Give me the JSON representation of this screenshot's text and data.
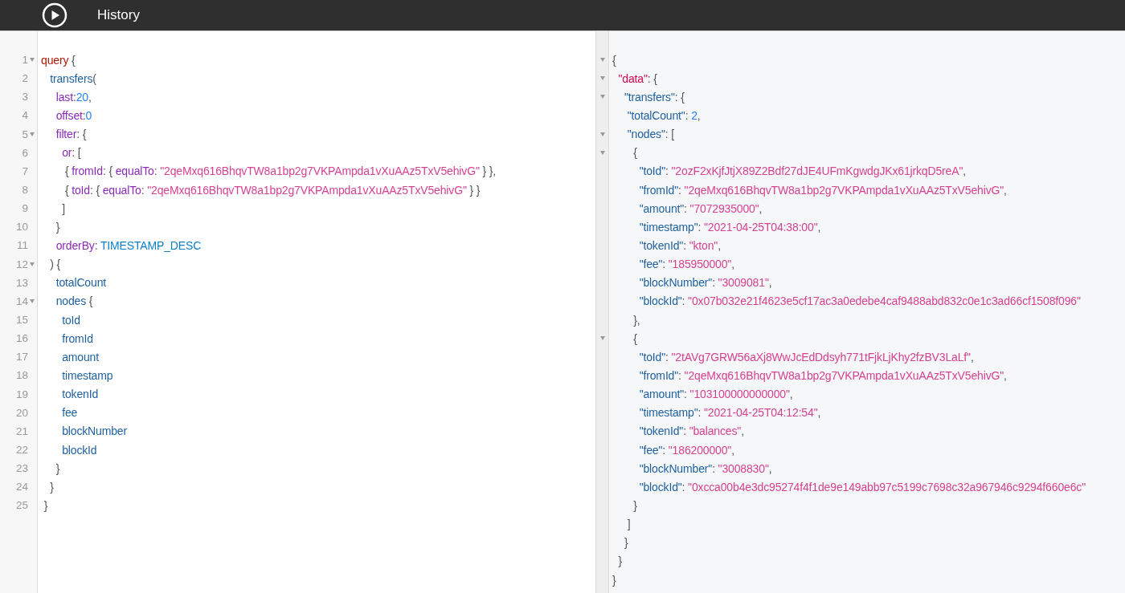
{
  "toolbar": {
    "title": "History"
  },
  "query_editor": {
    "lines": [
      {
        "number": "1",
        "foldable": true,
        "tokens": [
          {
            "text": "query",
            "kind": "keyword"
          },
          {
            "text": " {",
            "kind": "punct"
          }
        ]
      },
      {
        "number": "2",
        "foldable": false,
        "tokens": [
          {
            "text": "   transfers",
            "kind": "def"
          },
          {
            "text": "(",
            "kind": "punct"
          }
        ]
      },
      {
        "number": "3",
        "foldable": false,
        "tokens": [
          {
            "text": "     last",
            "kind": "arg"
          },
          {
            "text": ":",
            "kind": "punct"
          },
          {
            "text": "20",
            "kind": "number"
          },
          {
            "text": ",",
            "kind": "punct"
          }
        ]
      },
      {
        "number": "4",
        "foldable": false,
        "tokens": [
          {
            "text": "     offset",
            "kind": "arg"
          },
          {
            "text": ":",
            "kind": "punct"
          },
          {
            "text": "0",
            "kind": "number"
          }
        ]
      },
      {
        "number": "5",
        "foldable": true,
        "tokens": [
          {
            "text": "     filter",
            "kind": "arg"
          },
          {
            "text": ": {",
            "kind": "punct"
          }
        ]
      },
      {
        "number": "6",
        "foldable": false,
        "tokens": [
          {
            "text": "       or",
            "kind": "arg"
          },
          {
            "text": ": [",
            "kind": "punct"
          }
        ]
      },
      {
        "number": "7",
        "foldable": false,
        "tokens": [
          {
            "text": "        { ",
            "kind": "punct"
          },
          {
            "text": "fromId",
            "kind": "arg"
          },
          {
            "text": ": { ",
            "kind": "punct"
          },
          {
            "text": "equalTo",
            "kind": "arg"
          },
          {
            "text": ": ",
            "kind": "punct"
          },
          {
            "text": "\"2qeMxq616BhqvTW8a1bp2g7VKPAmpda1vXuAAz5TxV5ehivG\"",
            "kind": "string"
          },
          {
            "text": " } },",
            "kind": "punct"
          }
        ]
      },
      {
        "number": "8",
        "foldable": false,
        "tokens": [
          {
            "text": "        { ",
            "kind": "punct"
          },
          {
            "text": "toId",
            "kind": "arg"
          },
          {
            "text": ": { ",
            "kind": "punct"
          },
          {
            "text": "equalTo",
            "kind": "arg"
          },
          {
            "text": ": ",
            "kind": "punct"
          },
          {
            "text": "\"2qeMxq616BhqvTW8a1bp2g7VKPAmpda1vXuAAz5TxV5ehivG\"",
            "kind": "string"
          },
          {
            "text": " } }",
            "kind": "punct"
          }
        ]
      },
      {
        "number": "9",
        "foldable": false,
        "tokens": [
          {
            "text": "       ]",
            "kind": "punct"
          }
        ]
      },
      {
        "number": "10",
        "foldable": false,
        "tokens": [
          {
            "text": "     }",
            "kind": "punct"
          }
        ]
      },
      {
        "number": "11",
        "foldable": false,
        "tokens": [
          {
            "text": "     orderBy",
            "kind": "arg"
          },
          {
            "text": ": ",
            "kind": "punct"
          },
          {
            "text": "TIMESTAMP_DESC",
            "kind": "enum"
          }
        ]
      },
      {
        "number": "12",
        "foldable": true,
        "tokens": [
          {
            "text": "   ) {",
            "kind": "punct"
          }
        ]
      },
      {
        "number": "13",
        "foldable": false,
        "tokens": [
          {
            "text": "     totalCount",
            "kind": "def"
          }
        ]
      },
      {
        "number": "14",
        "foldable": true,
        "tokens": [
          {
            "text": "     nodes",
            "kind": "def"
          },
          {
            "text": " {",
            "kind": "punct"
          }
        ]
      },
      {
        "number": "15",
        "foldable": false,
        "tokens": [
          {
            "text": "       toId",
            "kind": "def"
          }
        ]
      },
      {
        "number": "16",
        "foldable": false,
        "tokens": [
          {
            "text": "       fromId",
            "kind": "def"
          }
        ]
      },
      {
        "number": "17",
        "foldable": false,
        "tokens": [
          {
            "text": "       amount",
            "kind": "def"
          }
        ]
      },
      {
        "number": "18",
        "foldable": false,
        "tokens": [
          {
            "text": "       timestamp",
            "kind": "def"
          }
        ]
      },
      {
        "number": "19",
        "foldable": false,
        "tokens": [
          {
            "text": "       tokenId",
            "kind": "def"
          }
        ]
      },
      {
        "number": "20",
        "foldable": false,
        "tokens": [
          {
            "text": "       fee",
            "kind": "def"
          }
        ]
      },
      {
        "number": "21",
        "foldable": false,
        "tokens": [
          {
            "text": "       blockNumber",
            "kind": "def"
          }
        ]
      },
      {
        "number": "22",
        "foldable": false,
        "tokens": [
          {
            "text": "       blockId",
            "kind": "def"
          }
        ]
      },
      {
        "number": "23",
        "foldable": false,
        "tokens": [
          {
            "text": "     }",
            "kind": "punct"
          }
        ]
      },
      {
        "number": "24",
        "foldable": false,
        "tokens": [
          {
            "text": "   }",
            "kind": "punct"
          }
        ]
      },
      {
        "number": "25",
        "foldable": false,
        "tokens": [
          {
            "text": " }",
            "kind": "punct"
          }
        ]
      }
    ]
  },
  "result_viewer": {
    "lines": [
      {
        "foldable": true,
        "tokens": [
          {
            "text": "{",
            "kind": "punct"
          }
        ]
      },
      {
        "foldable": true,
        "tokens": [
          {
            "text": "  \"data\"",
            "kind": "root-key"
          },
          {
            "text": ": {",
            "kind": "punct"
          }
        ]
      },
      {
        "foldable": true,
        "tokens": [
          {
            "text": "    \"transfers\"",
            "kind": "key"
          },
          {
            "text": ": {",
            "kind": "punct"
          }
        ]
      },
      {
        "foldable": false,
        "tokens": [
          {
            "text": "     \"totalCount\"",
            "kind": "key"
          },
          {
            "text": ": ",
            "kind": "punct"
          },
          {
            "text": "2",
            "kind": "number"
          },
          {
            "text": ",",
            "kind": "punct"
          }
        ]
      },
      {
        "foldable": true,
        "tokens": [
          {
            "text": "     \"nodes\"",
            "kind": "key"
          },
          {
            "text": ": [",
            "kind": "punct"
          }
        ]
      },
      {
        "foldable": true,
        "tokens": [
          {
            "text": "       {",
            "kind": "punct"
          }
        ]
      },
      {
        "foldable": false,
        "tokens": [
          {
            "text": "         \"toId\"",
            "kind": "key"
          },
          {
            "text": ": ",
            "kind": "punct"
          },
          {
            "text": "\"2ozF2xKjfJtjX89Z2Bdf27dJE4UFmKgwdgJKx61jrkqD5reA\"",
            "kind": "string"
          },
          {
            "text": ",",
            "kind": "punct"
          }
        ]
      },
      {
        "foldable": false,
        "tokens": [
          {
            "text": "         \"fromId\"",
            "kind": "key"
          },
          {
            "text": ": ",
            "kind": "punct"
          },
          {
            "text": "\"2qeMxq616BhqvTW8a1bp2g7VKPAmpda1vXuAAz5TxV5ehivG\"",
            "kind": "string"
          },
          {
            "text": ",",
            "kind": "punct"
          }
        ]
      },
      {
        "foldable": false,
        "tokens": [
          {
            "text": "         \"amount\"",
            "kind": "key"
          },
          {
            "text": ": ",
            "kind": "punct"
          },
          {
            "text": "\"7072935000\"",
            "kind": "string"
          },
          {
            "text": ",",
            "kind": "punct"
          }
        ]
      },
      {
        "foldable": false,
        "tokens": [
          {
            "text": "         \"timestamp\"",
            "kind": "key"
          },
          {
            "text": ": ",
            "kind": "punct"
          },
          {
            "text": "\"2021-04-25T04:38:00\"",
            "kind": "string"
          },
          {
            "text": ",",
            "kind": "punct"
          }
        ]
      },
      {
        "foldable": false,
        "tokens": [
          {
            "text": "         \"tokenId\"",
            "kind": "key"
          },
          {
            "text": ": ",
            "kind": "punct"
          },
          {
            "text": "\"kton\"",
            "kind": "string"
          },
          {
            "text": ",",
            "kind": "punct"
          }
        ]
      },
      {
        "foldable": false,
        "tokens": [
          {
            "text": "         \"fee\"",
            "kind": "key"
          },
          {
            "text": ": ",
            "kind": "punct"
          },
          {
            "text": "\"185950000\"",
            "kind": "string"
          },
          {
            "text": ",",
            "kind": "punct"
          }
        ]
      },
      {
        "foldable": false,
        "tokens": [
          {
            "text": "         \"blockNumber\"",
            "kind": "key"
          },
          {
            "text": ": ",
            "kind": "punct"
          },
          {
            "text": "\"3009081\"",
            "kind": "string"
          },
          {
            "text": ",",
            "kind": "punct"
          }
        ]
      },
      {
        "foldable": false,
        "tokens": [
          {
            "text": "         \"blockId\"",
            "kind": "key"
          },
          {
            "text": ": ",
            "kind": "punct"
          },
          {
            "text": "\"0x07b032e21f4623e5cf17ac3a0edebe4caf9488abd832c0e1c3ad66cf1508f096\"",
            "kind": "string"
          }
        ]
      },
      {
        "foldable": false,
        "tokens": [
          {
            "text": "       },",
            "kind": "punct"
          }
        ]
      },
      {
        "foldable": true,
        "tokens": [
          {
            "text": "       {",
            "kind": "punct"
          }
        ]
      },
      {
        "foldable": false,
        "tokens": [
          {
            "text": "         \"toId\"",
            "kind": "key"
          },
          {
            "text": ": ",
            "kind": "punct"
          },
          {
            "text": "\"2tAVg7GRW56aXj8WwJcEdDdsyh771tFjkLjKhy2fzBV3LaLf\"",
            "kind": "string"
          },
          {
            "text": ",",
            "kind": "punct"
          }
        ]
      },
      {
        "foldable": false,
        "tokens": [
          {
            "text": "         \"fromId\"",
            "kind": "key"
          },
          {
            "text": ": ",
            "kind": "punct"
          },
          {
            "text": "\"2qeMxq616BhqvTW8a1bp2g7VKPAmpda1vXuAAz5TxV5ehivG\"",
            "kind": "string"
          },
          {
            "text": ",",
            "kind": "punct"
          }
        ]
      },
      {
        "foldable": false,
        "tokens": [
          {
            "text": "         \"amount\"",
            "kind": "key"
          },
          {
            "text": ": ",
            "kind": "punct"
          },
          {
            "text": "\"103100000000000\"",
            "kind": "string"
          },
          {
            "text": ",",
            "kind": "punct"
          }
        ]
      },
      {
        "foldable": false,
        "tokens": [
          {
            "text": "         \"timestamp\"",
            "kind": "key"
          },
          {
            "text": ": ",
            "kind": "punct"
          },
          {
            "text": "\"2021-04-25T04:12:54\"",
            "kind": "string"
          },
          {
            "text": ",",
            "kind": "punct"
          }
        ]
      },
      {
        "foldable": false,
        "tokens": [
          {
            "text": "         \"tokenId\"",
            "kind": "key"
          },
          {
            "text": ": ",
            "kind": "punct"
          },
          {
            "text": "\"balances\"",
            "kind": "string"
          },
          {
            "text": ",",
            "kind": "punct"
          }
        ]
      },
      {
        "foldable": false,
        "tokens": [
          {
            "text": "         \"fee\"",
            "kind": "key"
          },
          {
            "text": ": ",
            "kind": "punct"
          },
          {
            "text": "\"186200000\"",
            "kind": "string"
          },
          {
            "text": ",",
            "kind": "punct"
          }
        ]
      },
      {
        "foldable": false,
        "tokens": [
          {
            "text": "         \"blockNumber\"",
            "kind": "key"
          },
          {
            "text": ": ",
            "kind": "punct"
          },
          {
            "text": "\"3008830\"",
            "kind": "string"
          },
          {
            "text": ",",
            "kind": "punct"
          }
        ]
      },
      {
        "foldable": false,
        "tokens": [
          {
            "text": "         \"blockId\"",
            "kind": "key"
          },
          {
            "text": ": ",
            "kind": "punct"
          },
          {
            "text": "\"0xcca00b4e3dc95274f4f1de9e149abb97c5199c7698c32a967946c9294f660e6c\"",
            "kind": "string"
          }
        ]
      },
      {
        "foldable": false,
        "tokens": [
          {
            "text": "       }",
            "kind": "punct"
          }
        ]
      },
      {
        "foldable": false,
        "tokens": [
          {
            "text": "     ]",
            "kind": "punct"
          }
        ]
      },
      {
        "foldable": false,
        "tokens": [
          {
            "text": "    }",
            "kind": "punct"
          }
        ]
      },
      {
        "foldable": false,
        "tokens": [
          {
            "text": "  }",
            "kind": "punct"
          }
        ]
      },
      {
        "foldable": false,
        "tokens": [
          {
            "text": "}",
            "kind": "punct"
          }
        ]
      }
    ]
  }
}
